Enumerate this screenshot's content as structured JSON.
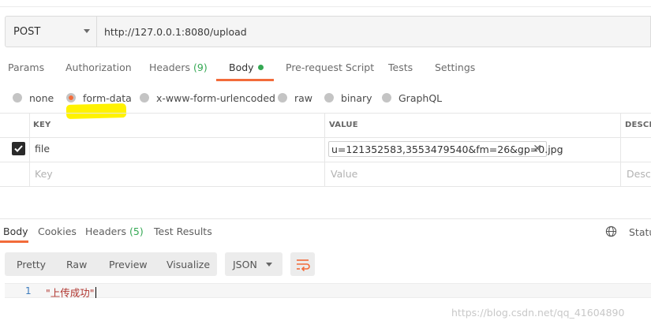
{
  "request": {
    "method": "POST",
    "url": "http://127.0.0.1:8080/upload"
  },
  "tabs": {
    "params": "Params",
    "authorization": "Authorization",
    "headers": "Headers",
    "headers_count": "(9)",
    "body": "Body",
    "prerequest": "Pre-request Script",
    "tests": "Tests",
    "settings": "Settings"
  },
  "body_modes": {
    "none": "none",
    "form_data": "form-data",
    "urlencoded": "x-www-form-urlencoded",
    "raw": "raw",
    "binary": "binary",
    "graphql": "GraphQL",
    "selected": "form-data"
  },
  "params_table": {
    "headers": {
      "key": "KEY",
      "value": "VALUE",
      "description": "DESCR"
    },
    "rows": [
      {
        "checked": true,
        "key": "file",
        "value": "u=121352583,3553479540&fm=26&gp=0.jpg",
        "description": ""
      }
    ],
    "placeholder": {
      "key": "Key",
      "value": "Value",
      "description": "Descri"
    }
  },
  "response": {
    "tabs": {
      "body": "Body",
      "cookies": "Cookies",
      "headers": "Headers",
      "headers_count": "(5)",
      "test_results": "Test Results"
    },
    "status_label": "Statu",
    "views": {
      "pretty": "Pretty",
      "raw": "Raw",
      "preview": "Preview",
      "visualize": "Visualize"
    },
    "format": "JSON",
    "lines": [
      {
        "number": "1",
        "text": "\"上传成功\""
      }
    ]
  },
  "watermark": "https://blog.csdn.net/qq_41604890",
  "colors": {
    "accent": "#f26b3a",
    "count_green": "#34a853",
    "highlight": "#fff200",
    "string_red": "#b0352f"
  }
}
